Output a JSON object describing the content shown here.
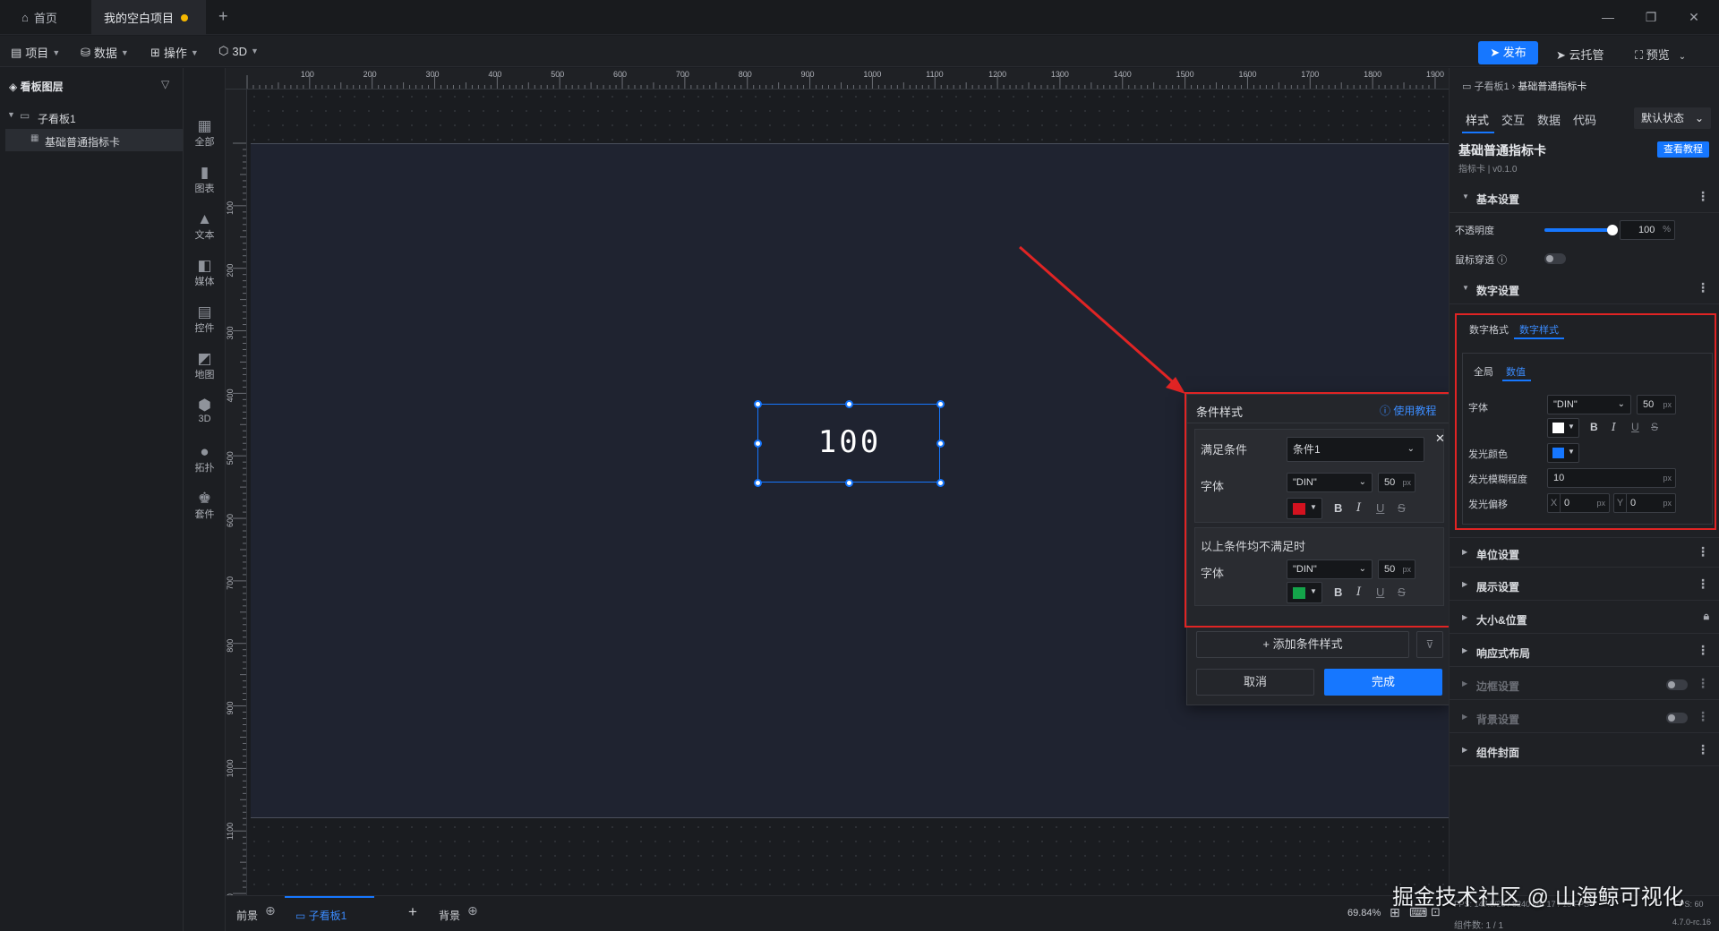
{
  "tabs": [
    {
      "label": "首页"
    },
    {
      "label": "我的空白项目"
    }
  ],
  "window": {
    "minimize": "—",
    "restore": "❐",
    "close": "✕",
    "new_tab": "+"
  },
  "menu": {
    "project": "项目",
    "data": "数据",
    "operate": "操作",
    "three_d": "3D",
    "publish": "发布",
    "cloud": "云托管",
    "preview": "预览"
  },
  "layers": {
    "title": "看板图层",
    "items": [
      {
        "label": "子看板1"
      },
      {
        "label": "基础普通指标卡"
      }
    ]
  },
  "components": [
    {
      "label": "全部",
      "icon": "grid-icon"
    },
    {
      "label": "图表",
      "icon": "chart-icon"
    },
    {
      "label": "文本",
      "icon": "text-icon"
    },
    {
      "label": "媒体",
      "icon": "media-icon"
    },
    {
      "label": "控件",
      "icon": "control-icon"
    },
    {
      "label": "地图",
      "icon": "map-icon"
    },
    {
      "label": "3D",
      "icon": "cube-icon"
    },
    {
      "label": "拓扑",
      "icon": "topology-icon"
    },
    {
      "label": "套件",
      "icon": "kit-icon"
    }
  ],
  "ruler": {
    "top": [
      "100",
      "200",
      "300",
      "400",
      "500",
      "600",
      "700",
      "800",
      "900",
      "1000",
      "1100",
      "1200",
      "1300",
      "1400",
      "1500",
      "1600",
      "1700",
      "1800",
      "1900"
    ],
    "left": [
      "100",
      "200",
      "300",
      "400",
      "500",
      "600",
      "700",
      "800",
      "900",
      "1000",
      "1100",
      "00"
    ]
  },
  "canvas": {
    "metric_value": "100"
  },
  "popup": {
    "title": "条件样式",
    "tutorial": "使用教程",
    "cond_label": "满足条件",
    "cond_value": "条件1",
    "font_label": "字体",
    "font_value": "\"DIN\"",
    "size_value": "50",
    "unit": "px",
    "else_label": "以上条件均不满足时",
    "font_label2": "字体",
    "font_value2": "\"DIN\"",
    "size_value2": "50",
    "add_style": "+ 添加条件样式",
    "cancel": "取消",
    "done": "完成",
    "color1": "#d4121f",
    "color2": "#14a44a"
  },
  "right": {
    "breadcrumb_parent": "子看板1",
    "breadcrumb_current": "基础普通指标卡",
    "tabs": [
      "样式",
      "交互",
      "数据",
      "代码"
    ],
    "state_select": "默认状态",
    "component_name": "基础普通指标卡",
    "component_meta": "指标卡 | v0.1.0",
    "tutorial_btn": "查看教程",
    "basic_section": "基本设置",
    "opacity_label": "不透明度",
    "opacity_value": "100",
    "opacity_unit": "%",
    "opacity_level": 1.0,
    "mouse_label": "鼠标穿透",
    "number_section": "数字设置",
    "num_tabs": [
      "数字格式",
      "数字样式"
    ],
    "sub_tabs": [
      "全局",
      "数值"
    ],
    "font_label": "字体",
    "font_value": "\"DIN\"",
    "font_size": "50",
    "unit": "px",
    "glow_color_label": "发光颜色",
    "glow_blur_label": "发光模糊程度",
    "glow_blur_value": "10",
    "glow_offset_label": "发光偏移",
    "offset_x_label": "X",
    "offset_x": "0",
    "offset_y_label": "Y",
    "offset_y": "0",
    "font_color": "#ffffff",
    "glow_color": "#1677ff",
    "sections": [
      "单位设置",
      "展示设置",
      "大小&位置",
      "响应式布局",
      "边框设置",
      "背景设置",
      "组件封面"
    ]
  },
  "bottom": {
    "foreground": "前景",
    "board_tab": "子看板1",
    "add": "+",
    "background": "背景",
    "zoom": "69.84%",
    "status_left": "FPS: 147.8/28 / 8240 MB 17 / 15 FPS",
    "fps": "FPS: 60",
    "count": "组件数: 1 / 1",
    "version": "4.7.0-rc.16",
    "watermark": "掘金技术社区 @ 山海鲸可视化"
  }
}
